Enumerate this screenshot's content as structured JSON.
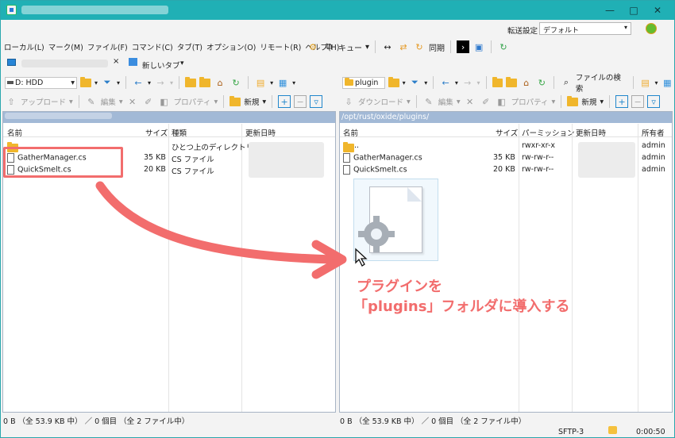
{
  "window": {
    "controls": [
      "—",
      "□",
      "✕"
    ]
  },
  "header": {
    "transfer_label": "転送設定",
    "transfer_value": "デフォルト",
    "menu": [
      "ローカル(L)",
      "マーク(M)",
      "ファイル(F)",
      "コマンド(C)",
      "タブ(T)",
      "オプション(O)",
      "リモート(R)",
      "ヘルプ(H)"
    ],
    "queue_label": "キュー",
    "sync_label": "同期"
  },
  "tabs": {
    "new_tab": "新しいタブ"
  },
  "left_toolbar": {
    "drive": "D: HDD",
    "upload": "アップロード",
    "edit": "編集",
    "properties": "プロパティ",
    "new": "新規"
  },
  "right_toolbar": {
    "folder": "plugin",
    "find": "ファイルの検索",
    "download": "ダウンロード",
    "edit": "編集",
    "properties": "プロパティ",
    "new": "新規"
  },
  "left_pane": {
    "columns": [
      "名前",
      "サイズ",
      "種類",
      "更新日時"
    ],
    "rows": [
      {
        "name": "",
        "size": "",
        "type": "ひとつ上のディレクトリ"
      },
      {
        "name": "GatherManager.cs",
        "size": "35 KB",
        "type": "CS ファイル"
      },
      {
        "name": "QuickSmelt.cs",
        "size": "20 KB",
        "type": "CS ファイル"
      }
    ]
  },
  "right_pane": {
    "path": "/opt/rust/oxide/plugins/",
    "columns": [
      "名前",
      "サイズ",
      "パーミッション",
      "更新日時",
      "所有者"
    ],
    "rows": [
      {
        "name": "..",
        "size": "",
        "perm": "rwxr-xr-x",
        "owner": "admin"
      },
      {
        "name": "GatherManager.cs",
        "size": "35 KB",
        "perm": "rw-rw-r--",
        "owner": "admin"
      },
      {
        "name": "QuickSmelt.cs",
        "size": "20 KB",
        "perm": "rw-rw-r--",
        "owner": "admin"
      }
    ]
  },
  "status": {
    "left": "0 B （全 53.9 KB 中） ／ 0 個目 （全 2 ファイル中）",
    "right": "0 B （全 53.9 KB 中） ／ 0 個目 （全 2 ファイル中）",
    "protocol": "SFTP-3",
    "time": "0:00:50"
  },
  "annotation": {
    "line1": "プラグインを",
    "line2": "「plugins」フォルダに導入する"
  },
  "colors": {
    "accent": "#20b0b5",
    "path_bar": "#a2b9d6",
    "annotation": "#f26d6d"
  }
}
